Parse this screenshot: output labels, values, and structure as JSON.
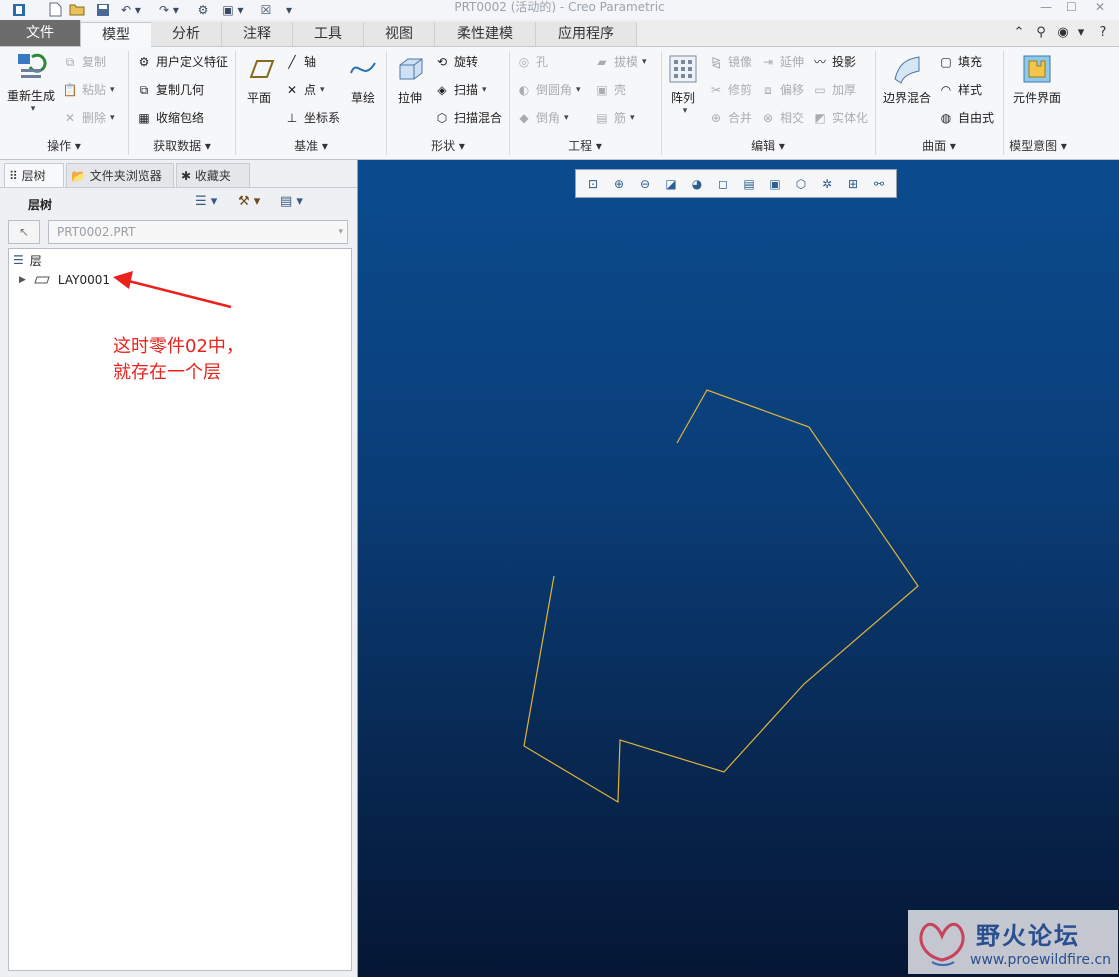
{
  "window": {
    "title": "PRT0002 (活动的) - Creo Parametric"
  },
  "menu_tabs": [
    {
      "label": "文件"
    },
    {
      "label": "模型"
    },
    {
      "label": "分析"
    },
    {
      "label": "注释"
    },
    {
      "label": "工具"
    },
    {
      "label": "视图"
    },
    {
      "label": "柔性建模"
    },
    {
      "label": "应用程序"
    }
  ],
  "ribbon": {
    "operations": {
      "regen": "重新生成",
      "copy": "复制",
      "paste": "粘贴",
      "delete": "删除",
      "group": "操作"
    },
    "get_data": {
      "udf": "用户定义特征",
      "copy_geom": "复制几何",
      "shrinkwrap": "收缩包络",
      "group": "获取数据"
    },
    "datum": {
      "plane": "平面",
      "axis": "轴",
      "point": "点",
      "csys": "坐标系",
      "sketch": "草绘",
      "group": "基准"
    },
    "shapes": {
      "extrude": "拉伸",
      "revolve": "旋转",
      "sweep": "扫描",
      "swept_blend": "扫描混合",
      "group": "形状"
    },
    "engineering": {
      "hole": "孔",
      "round": "倒圆角",
      "chamfer": "倒角",
      "draft": "拔模",
      "shell": "壳",
      "rib": "筋",
      "group": "工程"
    },
    "editing": {
      "pattern": "阵列",
      "mirror": "镜像",
      "trim": "修剪",
      "merge": "合并",
      "extend": "延伸",
      "offset": "偏移",
      "intersect": "相交",
      "project": "投影",
      "thicken": "加厚",
      "solidify": "实体化",
      "group": "编辑"
    },
    "surfaces": {
      "boundary_blend": "边界混合",
      "fill": "填充",
      "style": "样式",
      "freestyle": "自由式",
      "group": "曲面"
    },
    "model_intent": {
      "component_interface": "元件界面",
      "group": "模型意图"
    }
  },
  "left_panel": {
    "tabs": [
      {
        "label": "层树"
      },
      {
        "label": "文件夹浏览器"
      },
      {
        "label": "收藏夹"
      }
    ],
    "header": "层树",
    "model_selector": "PRT0002.PRT",
    "tree_root": "层",
    "tree_items": [
      {
        "label": "LAY0001"
      }
    ]
  },
  "annotation": {
    "line1": "这时零件02中，",
    "line2": "就存在一个层",
    "color": "#e8231d"
  },
  "viewport": {
    "background_top": "#0b4c8f",
    "background_bottom": "#051634",
    "curve_color": "#e0b43a"
  },
  "watermark": {
    "title": "野火论坛",
    "url": "www.proewildfire.cn"
  }
}
